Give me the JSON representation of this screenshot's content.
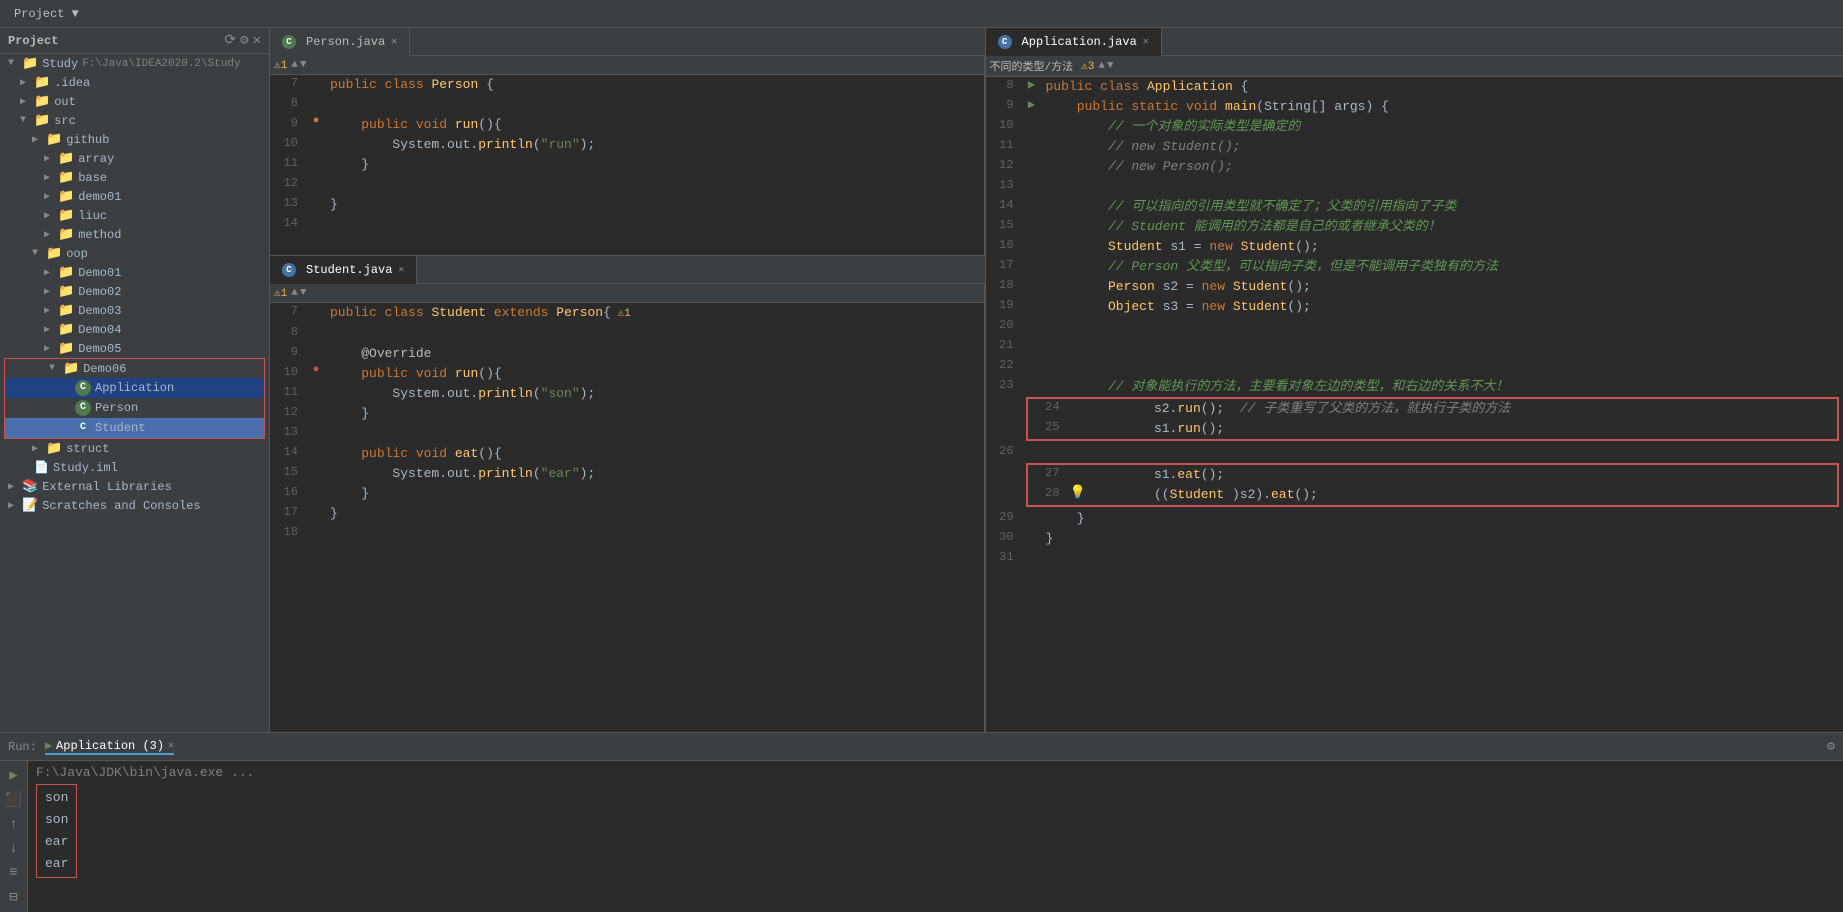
{
  "topbar": {
    "items": [
      "Project",
      "▼"
    ]
  },
  "sidebar": {
    "title": "Project",
    "root": "Study",
    "root_path": "F:\\Java\\IDEA2020.2\\Study",
    "items": [
      {
        "id": "idea",
        "label": ".idea",
        "indent": 2,
        "type": "folder",
        "expanded": false
      },
      {
        "id": "out",
        "label": "out",
        "indent": 2,
        "type": "folder",
        "expanded": false
      },
      {
        "id": "src",
        "label": "src",
        "indent": 2,
        "type": "folder",
        "expanded": true
      },
      {
        "id": "github",
        "label": "github",
        "indent": 3,
        "type": "folder",
        "expanded": false
      },
      {
        "id": "array",
        "label": "array",
        "indent": 4,
        "type": "folder",
        "expanded": false
      },
      {
        "id": "base",
        "label": "base",
        "indent": 4,
        "type": "folder",
        "expanded": false
      },
      {
        "id": "demo01",
        "label": "demo01",
        "indent": 4,
        "type": "folder",
        "expanded": false
      },
      {
        "id": "liuc",
        "label": "liuc",
        "indent": 4,
        "type": "folder",
        "expanded": false
      },
      {
        "id": "method",
        "label": "method",
        "indent": 4,
        "type": "folder",
        "expanded": false
      },
      {
        "id": "oop",
        "label": "oop",
        "indent": 3,
        "type": "folder",
        "expanded": true
      },
      {
        "id": "Demo01",
        "label": "Demo01",
        "indent": 4,
        "type": "folder",
        "expanded": false
      },
      {
        "id": "Demo02",
        "label": "Demo02",
        "indent": 4,
        "type": "folder",
        "expanded": false
      },
      {
        "id": "Demo03",
        "label": "Demo03",
        "indent": 4,
        "type": "folder",
        "expanded": false
      },
      {
        "id": "Demo04",
        "label": "Demo04",
        "indent": 4,
        "type": "folder",
        "expanded": false
      },
      {
        "id": "Demo05",
        "label": "Demo05",
        "indent": 4,
        "type": "folder",
        "expanded": false
      },
      {
        "id": "Demo06",
        "label": "Demo06",
        "indent": 4,
        "type": "folder",
        "expanded": true
      },
      {
        "id": "Application",
        "label": "Application",
        "indent": 5,
        "type": "java",
        "selected": true
      },
      {
        "id": "Person",
        "label": "Person",
        "indent": 5,
        "type": "java"
      },
      {
        "id": "Student",
        "label": "Student",
        "indent": 5,
        "type": "java",
        "highlighted": true
      },
      {
        "id": "struct",
        "label": "struct",
        "indent": 3,
        "type": "folder",
        "expanded": false
      },
      {
        "id": "Study_iml",
        "label": "Study.iml",
        "indent": 2,
        "type": "iml"
      },
      {
        "id": "ExternalLibraries",
        "label": "External Libraries",
        "indent": 1,
        "type": "ext"
      },
      {
        "id": "ScratchesConsoles",
        "label": "Scratches and Consoles",
        "indent": 1,
        "type": "scratch"
      }
    ]
  },
  "tabs_left": {
    "tabs": [
      {
        "id": "person",
        "label": "Person.java",
        "active": false
      },
      {
        "id": "student",
        "label": "Student.java",
        "active": true
      }
    ]
  },
  "tabs_right": {
    "tabs": [
      {
        "id": "application",
        "label": "Application.java",
        "active": true
      }
    ]
  },
  "person_code": [
    {
      "n": 7,
      "content": "public class Person {",
      "gutter": ""
    },
    {
      "n": 8,
      "content": "",
      "gutter": ""
    },
    {
      "n": 9,
      "content": "    public void run(){",
      "gutter": "dot"
    },
    {
      "n": 10,
      "content": "        System.out.println(\"run\");",
      "gutter": ""
    },
    {
      "n": 11,
      "content": "    }",
      "gutter": ""
    },
    {
      "n": 12,
      "content": "",
      "gutter": ""
    },
    {
      "n": 13,
      "content": "}",
      "gutter": ""
    },
    {
      "n": 14,
      "content": "",
      "gutter": ""
    }
  ],
  "student_code": [
    {
      "n": 7,
      "content": "public class Student extends Person{",
      "gutter": "",
      "warn": true
    },
    {
      "n": 8,
      "content": "",
      "gutter": ""
    },
    {
      "n": 9,
      "content": "    @Override",
      "gutter": ""
    },
    {
      "n": 10,
      "content": "    public void run(){",
      "gutter": "dot-red"
    },
    {
      "n": 11,
      "content": "        System.out.println(\"son\");",
      "gutter": ""
    },
    {
      "n": 12,
      "content": "    }",
      "gutter": ""
    },
    {
      "n": 13,
      "content": "",
      "gutter": ""
    },
    {
      "n": 14,
      "content": "    public void eat(){",
      "gutter": ""
    },
    {
      "n": 15,
      "content": "        System.out.println(\"ear\");",
      "gutter": ""
    },
    {
      "n": 16,
      "content": "    }",
      "gutter": ""
    },
    {
      "n": 17,
      "content": "}",
      "gutter": ""
    },
    {
      "n": 18,
      "content": "",
      "gutter": ""
    }
  ],
  "application_code": [
    {
      "n": 8,
      "content": "public class Application {",
      "gutter": "arrow"
    },
    {
      "n": 9,
      "content": "    public static void main(String[] args) {",
      "gutter": "arrow"
    },
    {
      "n": 10,
      "content": "        // 一个对象的实际类型是确定的",
      "gutter": "",
      "type": "comment-cn"
    },
    {
      "n": 11,
      "content": "        // new Student();",
      "gutter": "",
      "type": "comment"
    },
    {
      "n": 12,
      "content": "        // new Person();",
      "gutter": "",
      "type": "comment"
    },
    {
      "n": 13,
      "content": "",
      "gutter": ""
    },
    {
      "n": 14,
      "content": "        // 可以指向的引用类型就不确定了；父类的引用指向了子类",
      "gutter": "",
      "type": "comment-cn"
    },
    {
      "n": 15,
      "content": "        // Student 能调用的方法都是自己的或者继承父类的！",
      "gutter": "",
      "type": "comment-cn"
    },
    {
      "n": 16,
      "content": "        Student s1 = new Student();",
      "gutter": ""
    },
    {
      "n": 17,
      "content": "        // Person 父类型，可以指向子类，但是不能调用子类独有的方法",
      "gutter": "",
      "type": "comment-cn"
    },
    {
      "n": 18,
      "content": "        Person s2 = new Student();",
      "gutter": ""
    },
    {
      "n": 19,
      "content": "        Object s3 = new Student();",
      "gutter": ""
    },
    {
      "n": 20,
      "content": "",
      "gutter": ""
    },
    {
      "n": 21,
      "content": "",
      "gutter": ""
    },
    {
      "n": 22,
      "content": "",
      "gutter": ""
    },
    {
      "n": 23,
      "content": "        // 对象能执行的方法，主要看对象左边的类型，和右边的关系不大！",
      "gutter": "",
      "type": "comment-cn"
    },
    {
      "n": 24,
      "content": "        s2.run();  //  子类重写了父类的方法，就执行子类的方法",
      "gutter": ""
    },
    {
      "n": 25,
      "content": "        s1.run();",
      "gutter": ""
    },
    {
      "n": 26,
      "content": "",
      "gutter": ""
    },
    {
      "n": 27,
      "content": "        s1.eat();",
      "gutter": ""
    },
    {
      "n": 28,
      "content": "        ((Student )s2).eat();",
      "gutter": "bulb"
    },
    {
      "n": 29,
      "content": "    }",
      "gutter": ""
    },
    {
      "n": 30,
      "content": "}",
      "gutter": ""
    },
    {
      "n": 31,
      "content": "",
      "gutter": ""
    }
  ],
  "run_panel": {
    "tab_label": "Application (3)",
    "path_line": "F:\\Java\\JDK\\bin\\java.exe ...",
    "output_lines": [
      "son",
      "son",
      "ear",
      "ear"
    ]
  }
}
